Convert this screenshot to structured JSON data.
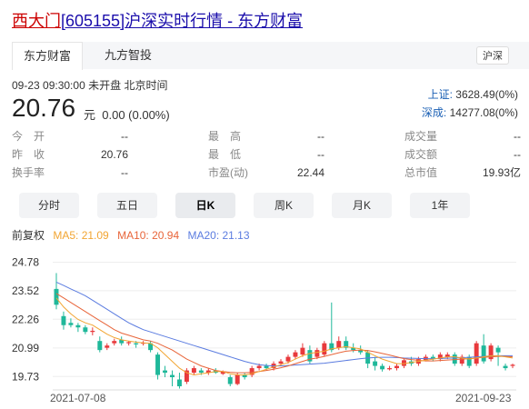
{
  "header": {
    "name": "西大门",
    "code": "[605155]",
    "suffix": "沪深实时行情 - 东方财富"
  },
  "tabs": [
    {
      "label": "东方财富"
    },
    {
      "label": "九方智投"
    }
  ],
  "market_tag": "沪深",
  "quote": {
    "datetime": "09-23 09:30:00",
    "status": "未开盘",
    "timezone": "北京时间",
    "price": "20.76",
    "unit": "元",
    "change": "0.00 (0.00%)"
  },
  "indices": [
    {
      "label": "上证:",
      "value": "3628.49(0%)"
    },
    {
      "label": "深成:",
      "value": "14277.08(0%)"
    }
  ],
  "stats": [
    [
      {
        "k": "今　开",
        "v": "--"
      },
      {
        "k": "最　高",
        "v": "--"
      },
      {
        "k": "成交量",
        "v": "--"
      }
    ],
    [
      {
        "k": "昨　收",
        "v": "20.76"
      },
      {
        "k": "最　低",
        "v": "--"
      },
      {
        "k": "成交额",
        "v": "--"
      }
    ],
    [
      {
        "k": "换手率",
        "v": "--"
      },
      {
        "k": "市盈(动)",
        "v": "22.44"
      },
      {
        "k": "总市值",
        "v": "19.93亿"
      }
    ]
  ],
  "periods": [
    {
      "label": "分时"
    },
    {
      "label": "五日"
    },
    {
      "label": "日K"
    },
    {
      "label": "周K"
    },
    {
      "label": "月K"
    },
    {
      "label": "1年"
    }
  ],
  "active_period": "日K",
  "ma_legend": {
    "adjust": "前复权",
    "ma5": "MA5: 21.09",
    "ma10": "MA10: 20.94",
    "ma20": "MA20: 21.13"
  },
  "colors": {
    "up": "#e8393c",
    "down": "#1fb89a",
    "ma5": "#f2a532",
    "ma10": "#e8653a",
    "ma20": "#5b7ce0"
  },
  "chart_data": {
    "type": "candlestick",
    "y_ticks": [
      "24.78",
      "23.52",
      "22.26",
      "20.99",
      "19.73"
    ],
    "x_labels": [
      "2021-07-08",
      "2021-09-23"
    ],
    "ylim": [
      19.3,
      25.0
    ],
    "candles": [
      {
        "o": 23.6,
        "c": 22.9,
        "h": 24.3,
        "l": 22.7
      },
      {
        "o": 22.4,
        "c": 22.0,
        "h": 22.6,
        "l": 21.8
      },
      {
        "o": 22.1,
        "c": 22.0,
        "h": 22.3,
        "l": 21.9
      },
      {
        "o": 22.0,
        "c": 21.9,
        "h": 22.1,
        "l": 21.7
      },
      {
        "o": 21.9,
        "c": 21.7,
        "h": 22.0,
        "l": 21.6
      },
      {
        "o": 21.7,
        "c": 21.75,
        "h": 21.9,
        "l": 21.55
      },
      {
        "o": 21.3,
        "c": 20.9,
        "h": 21.5,
        "l": 20.8
      },
      {
        "o": 21.0,
        "c": 21.1,
        "h": 21.2,
        "l": 20.9
      },
      {
        "o": 21.2,
        "c": 21.3,
        "h": 21.4,
        "l": 21.1
      },
      {
        "o": 21.35,
        "c": 21.2,
        "h": 21.5,
        "l": 21.1
      },
      {
        "o": 21.2,
        "c": 21.25,
        "h": 21.3,
        "l": 21.1
      },
      {
        "o": 21.2,
        "c": 21.15,
        "h": 21.3,
        "l": 21.0
      },
      {
        "o": 21.2,
        "c": 21.22,
        "h": 21.3,
        "l": 21.1
      },
      {
        "o": 21.2,
        "c": 20.9,
        "h": 21.3,
        "l": 20.8
      },
      {
        "o": 20.7,
        "c": 19.8,
        "h": 20.8,
        "l": 19.6
      },
      {
        "o": 20.0,
        "c": 19.9,
        "h": 20.2,
        "l": 19.7
      },
      {
        "o": 19.8,
        "c": 19.7,
        "h": 20.0,
        "l": 19.3
      },
      {
        "o": 19.6,
        "c": 19.3,
        "h": 19.9,
        "l": 19.2
      },
      {
        "o": 19.5,
        "c": 20.0,
        "h": 20.1,
        "l": 19.4
      },
      {
        "o": 19.9,
        "c": 20.1,
        "h": 20.2,
        "l": 19.8
      },
      {
        "o": 20.0,
        "c": 19.9,
        "h": 20.1,
        "l": 19.8
      },
      {
        "o": 19.9,
        "c": 20.0,
        "h": 20.1,
        "l": 19.8
      },
      {
        "o": 20.0,
        "c": 19.9,
        "h": 20.1,
        "l": 19.85
      },
      {
        "o": 19.85,
        "c": 19.95,
        "h": 20.0,
        "l": 19.8
      },
      {
        "o": 19.7,
        "c": 19.4,
        "h": 19.8,
        "l": 19.3
      },
      {
        "o": 19.4,
        "c": 19.8,
        "h": 19.9,
        "l": 19.35
      },
      {
        "o": 19.8,
        "c": 19.7,
        "h": 19.9,
        "l": 19.6
      },
      {
        "o": 19.8,
        "c": 20.1,
        "h": 20.2,
        "l": 19.7
      },
      {
        "o": 20.1,
        "c": 20.2,
        "h": 20.3,
        "l": 20.0
      },
      {
        "o": 20.2,
        "c": 20.1,
        "h": 20.3,
        "l": 20.0
      },
      {
        "o": 20.1,
        "c": 20.3,
        "h": 20.4,
        "l": 20.0
      },
      {
        "o": 20.3,
        "c": 20.4,
        "h": 20.5,
        "l": 20.2
      },
      {
        "o": 20.4,
        "c": 20.6,
        "h": 20.7,
        "l": 20.3
      },
      {
        "o": 20.6,
        "c": 20.8,
        "h": 20.9,
        "l": 20.5
      },
      {
        "o": 20.7,
        "c": 21.0,
        "h": 21.2,
        "l": 20.6
      },
      {
        "o": 20.9,
        "c": 20.4,
        "h": 21.1,
        "l": 20.3
      },
      {
        "o": 20.6,
        "c": 20.9,
        "h": 21.0,
        "l": 20.5
      },
      {
        "o": 20.7,
        "c": 21.2,
        "h": 21.3,
        "l": 20.6
      },
      {
        "o": 21.2,
        "c": 20.9,
        "h": 23.0,
        "l": 20.8
      },
      {
        "o": 21.0,
        "c": 21.3,
        "h": 21.5,
        "l": 20.9
      },
      {
        "o": 21.3,
        "c": 21.0,
        "h": 21.5,
        "l": 20.9
      },
      {
        "o": 21.0,
        "c": 20.9,
        "h": 21.2,
        "l": 20.8
      },
      {
        "o": 20.9,
        "c": 20.8,
        "h": 21.1,
        "l": 20.7
      },
      {
        "o": 20.8,
        "c": 20.3,
        "h": 20.9,
        "l": 20.1
      },
      {
        "o": 20.4,
        "c": 20.2,
        "h": 20.6,
        "l": 20.0
      },
      {
        "o": 20.2,
        "c": 20.05,
        "h": 20.3,
        "l": 19.95
      },
      {
        "o": 20.05,
        "c": 20.1,
        "h": 20.2,
        "l": 20.0
      },
      {
        "o": 20.1,
        "c": 20.2,
        "h": 20.3,
        "l": 20.0
      },
      {
        "o": 20.2,
        "c": 20.45,
        "h": 20.5,
        "l": 20.1
      },
      {
        "o": 20.4,
        "c": 20.3,
        "h": 20.6,
        "l": 20.2
      },
      {
        "o": 20.3,
        "c": 20.5,
        "h": 20.6,
        "l": 20.2
      },
      {
        "o": 20.45,
        "c": 20.6,
        "h": 20.7,
        "l": 20.4
      },
      {
        "o": 20.6,
        "c": 20.5,
        "h": 20.7,
        "l": 20.4
      },
      {
        "o": 20.5,
        "c": 20.7,
        "h": 20.8,
        "l": 20.4
      },
      {
        "o": 20.6,
        "c": 20.7,
        "h": 20.8,
        "l": 20.5
      },
      {
        "o": 20.7,
        "c": 20.3,
        "h": 20.8,
        "l": 20.2
      },
      {
        "o": 20.3,
        "c": 20.6,
        "h": 20.7,
        "l": 20.2
      },
      {
        "o": 20.6,
        "c": 20.2,
        "h": 20.7,
        "l": 20.1
      },
      {
        "o": 20.3,
        "c": 21.2,
        "h": 21.3,
        "l": 20.2
      },
      {
        "o": 21.1,
        "c": 20.4,
        "h": 21.6,
        "l": 20.3
      },
      {
        "o": 20.5,
        "c": 21.1,
        "h": 21.2,
        "l": 20.4
      },
      {
        "o": 21.0,
        "c": 20.8,
        "h": 21.1,
        "l": 20.2
      },
      {
        "o": 20.2,
        "c": 20.1,
        "h": 20.3,
        "l": 20.0
      },
      {
        "o": 20.2,
        "c": 20.25,
        "h": 20.3,
        "l": 20.1
      }
    ],
    "ma5": [
      23.2,
      22.8,
      22.5,
      22.25,
      22.1,
      22.0,
      21.8,
      21.6,
      21.45,
      21.35,
      21.3,
      21.25,
      21.22,
      21.2,
      21.0,
      20.7,
      20.4,
      20.1,
      19.9,
      19.8,
      19.85,
      19.9,
      19.95,
      19.95,
      19.85,
      19.8,
      19.8,
      19.85,
      19.95,
      20.05,
      20.15,
      20.25,
      20.35,
      20.5,
      20.65,
      20.75,
      20.8,
      20.85,
      20.95,
      21.0,
      21.05,
      21.0,
      20.95,
      20.8,
      20.65,
      20.5,
      20.4,
      20.3,
      20.3,
      20.35,
      20.4,
      20.45,
      20.5,
      20.55,
      20.6,
      20.6,
      20.55,
      20.5,
      20.55,
      20.6,
      20.65,
      20.65,
      20.6,
      20.55
    ],
    "ma10": [
      23.4,
      23.2,
      23.0,
      22.8,
      22.6,
      22.4,
      22.2,
      22.0,
      21.8,
      21.65,
      21.55,
      21.45,
      21.35,
      21.3,
      21.2,
      21.05,
      20.9,
      20.7,
      20.5,
      20.35,
      20.2,
      20.1,
      20.0,
      19.95,
      19.92,
      19.9,
      19.9,
      19.92,
      19.95,
      20.0,
      20.05,
      20.12,
      20.2,
      20.3,
      20.4,
      20.5,
      20.55,
      20.62,
      20.7,
      20.78,
      20.85,
      20.88,
      20.9,
      20.88,
      20.82,
      20.75,
      20.68,
      20.6,
      20.52,
      20.48,
      20.45,
      20.42,
      20.42,
      20.44,
      20.46,
      20.48,
      20.5,
      20.52,
      20.55,
      20.58,
      20.6,
      20.62,
      20.62,
      20.6
    ],
    "ma20": [
      23.9,
      23.75,
      23.6,
      23.45,
      23.3,
      23.1,
      22.9,
      22.7,
      22.5,
      22.3,
      22.1,
      21.95,
      21.8,
      21.7,
      21.6,
      21.5,
      21.4,
      21.3,
      21.2,
      21.1,
      21.0,
      20.9,
      20.8,
      20.7,
      20.6,
      20.5,
      20.4,
      20.32,
      20.25,
      20.22,
      20.2,
      20.2,
      20.22,
      20.24,
      20.26,
      20.28,
      20.3,
      20.32,
      20.36,
      20.4,
      20.44,
      20.48,
      20.52,
      20.55,
      20.57,
      20.58,
      20.58,
      20.57,
      20.55,
      20.54,
      20.53,
      20.52,
      20.52,
      20.53,
      20.54,
      20.55,
      20.56,
      20.58,
      20.6,
      20.62,
      20.64,
      20.65,
      20.65,
      20.65
    ]
  }
}
